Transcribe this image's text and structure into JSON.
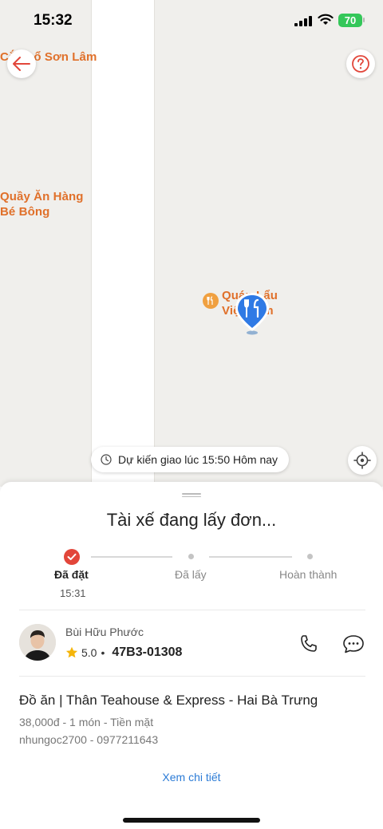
{
  "status_bar": {
    "time": "15:32",
    "battery": "70"
  },
  "map": {
    "pois": [
      {
        "text": "Cắt tỉ ổ Sơn Lâm"
      },
      {
        "text": "Quầy Ăn Hàng"
      },
      {
        "text": "Bé Bông"
      },
      {
        "text": "Quán Lẩu"
      },
      {
        "text": "Việt Nam"
      }
    ],
    "eta": "Dự kiến giao lúc 15:50 Hôm nay"
  },
  "sheet": {
    "title": "Tài xế đang lấy đơn...",
    "steps": [
      {
        "label": "Đã đặt",
        "time": "15:31",
        "done": true
      },
      {
        "label": "Đã lấy",
        "done": false
      },
      {
        "label": "Hoàn thành",
        "done": false
      }
    ],
    "driver": {
      "name": "Bùi Hữu Phước",
      "rating": "5.0",
      "separator": "•",
      "plate": "47B3-01308"
    },
    "order": {
      "title": "Đồ ăn | Thân Teahouse & Express - Hai Bà Trưng",
      "summary": "38,000đ - 1 món  - Tiền mặt",
      "customer": "nhungoc2700 - 0977211643"
    },
    "detail_link": "Xem chi tiết"
  },
  "colors": {
    "accent": "#e2463a",
    "poi": "#e0702a",
    "link": "#2b7bd6",
    "battery": "#34c759"
  }
}
